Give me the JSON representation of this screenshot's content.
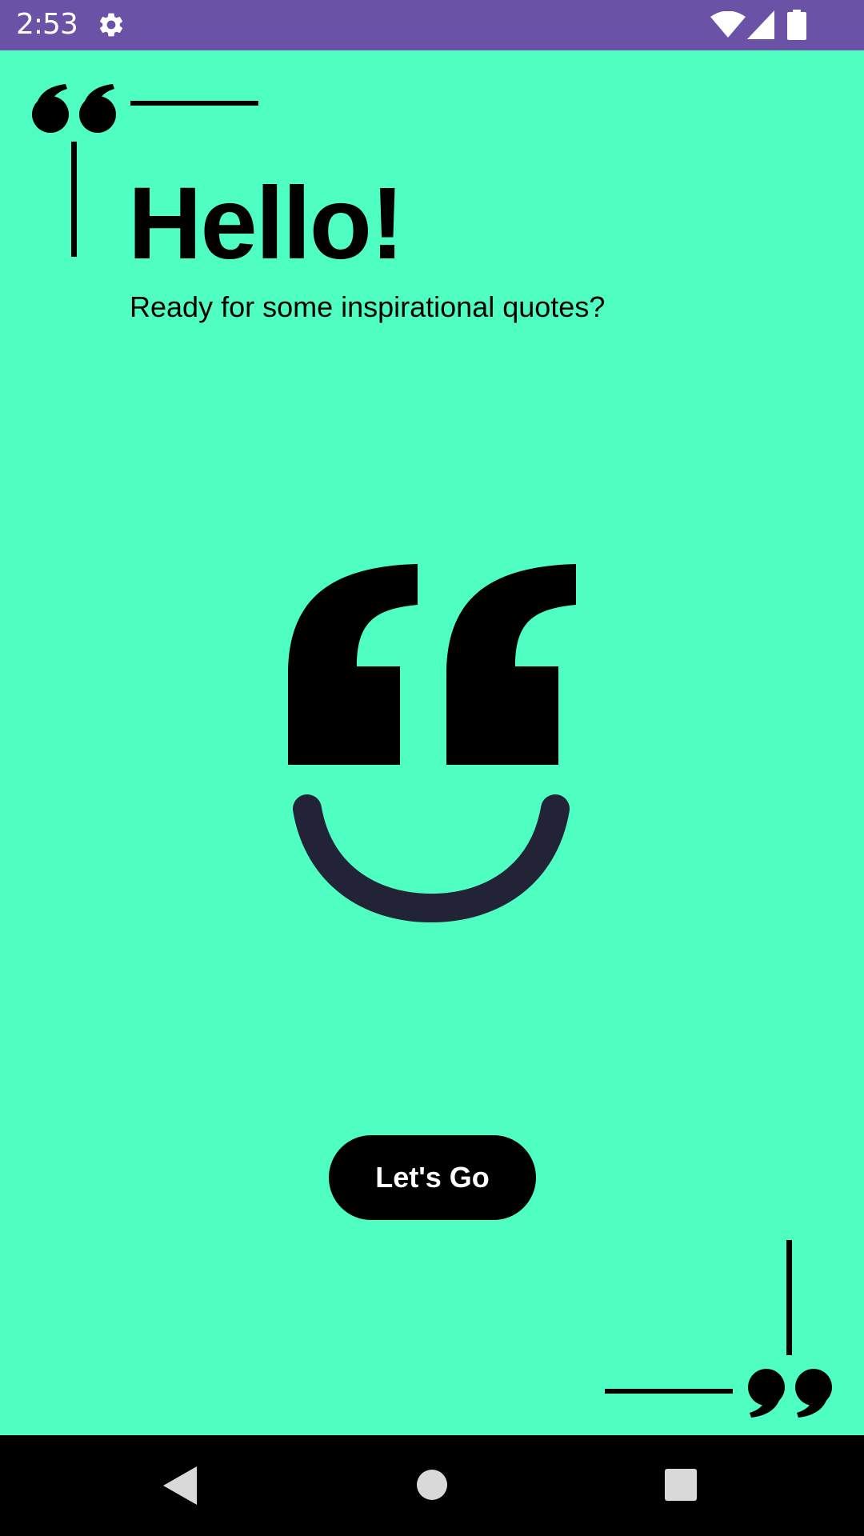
{
  "status_bar": {
    "time": "2:53",
    "background_color": "#6a53a6",
    "icons": [
      "gear-icon",
      "wifi-icon",
      "signal-icon",
      "battery-icon"
    ]
  },
  "welcome": {
    "title": "Hello!",
    "subtitle": "Ready for some inspirational quotes?",
    "background_color": "#4fffc2",
    "logo_icon": "quote-smile-icon"
  },
  "actions": {
    "start_label": "Let's Go"
  },
  "nav_bar": {
    "icons": [
      "back-icon",
      "home-icon",
      "recents-icon"
    ]
  }
}
